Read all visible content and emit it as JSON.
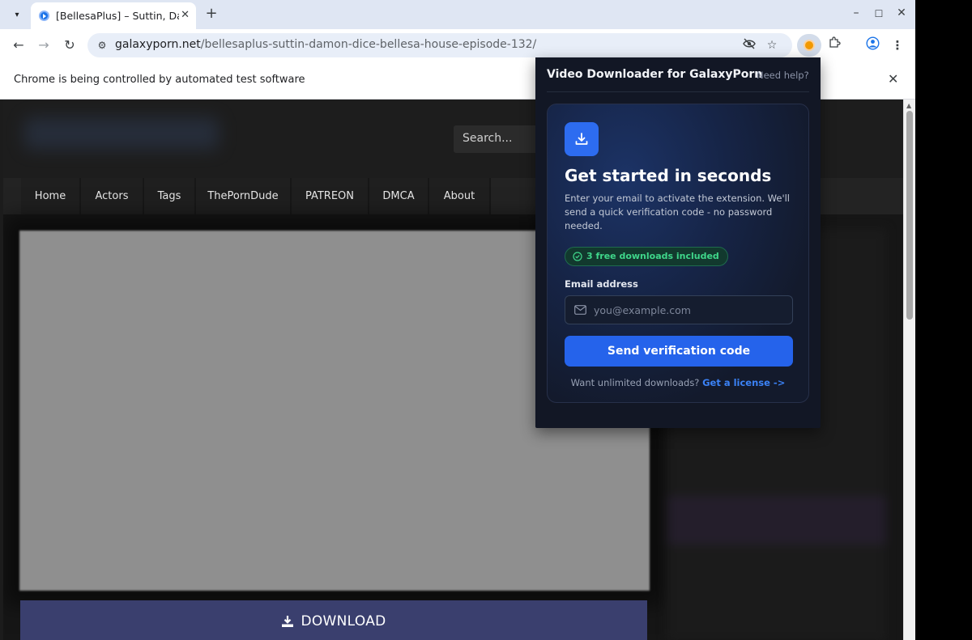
{
  "browser": {
    "tab_title": "[BellesaPlus] – Suttin, Da",
    "url_host": "galaxyporn.net",
    "url_path": "/bellesaplus-suttin-damon-dice-bellesa-house-episode-132/",
    "infobar_text": "Chrome is being controlled by automated test software"
  },
  "site": {
    "search_placeholder": "Search...",
    "nav": [
      "Home",
      "Actors",
      "Tags",
      "ThePornDude",
      "PATREON",
      "DMCA",
      "About"
    ],
    "download_label": "DOWNLOAD"
  },
  "popup": {
    "title": "Video Downloader for GalaxyPorn",
    "help": "Need help?",
    "heading": "Get started in seconds",
    "description": "Enter your email to activate the extension. We'll send a quick verification code - no password needed.",
    "badge": "3 free downloads included",
    "email_label": "Email address",
    "email_placeholder": "you@example.com",
    "send_button": "Send verification code",
    "footer_text": "Want unlimited downloads?",
    "footer_link": "Get a license ->"
  },
  "colors": {
    "accent": "#2563eb",
    "badge_green": "#3fd68a",
    "popup_bg": "#121725",
    "download_bg": "#3a3f6e"
  },
  "icons": [
    "chevron-down-icon",
    "tab-favicon",
    "close-icon",
    "plus-icon",
    "minimize-icon",
    "maximize-icon",
    "back-icon",
    "forward-icon",
    "reload-icon",
    "site-info-icon",
    "eye-off-icon",
    "star-icon",
    "extension-active-icon",
    "puzzle-icon",
    "profile-icon",
    "kebab-menu-icon",
    "download-icon",
    "check-circle-icon",
    "mail-icon"
  ]
}
